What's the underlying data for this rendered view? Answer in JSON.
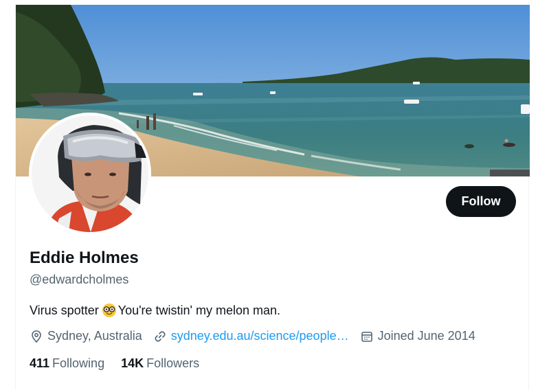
{
  "profile": {
    "name": "Eddie Holmes",
    "handle": "@edwardcholmes",
    "bio_before_emoji": "Virus spotter",
    "bio_emoji": "nerd-face-emoji",
    "bio_after_emoji": "You're twistin' my melon man.",
    "location": "Sydney, Australia",
    "website": "sydney.edu.au/science/people…",
    "joined": "Joined June 2014"
  },
  "actions": {
    "follow_label": "Follow"
  },
  "stats": {
    "following_count": "411",
    "following_label": "Following",
    "followers_count": "14K",
    "followers_label": "Followers"
  },
  "icons": {
    "location": "map-pin-icon",
    "website": "link-icon",
    "joined": "calendar-icon"
  },
  "colors": {
    "text_primary": "#0f1419",
    "text_secondary": "#536471",
    "link": "#1d9bf0",
    "button_bg": "#0f1419",
    "button_text": "#ffffff"
  }
}
